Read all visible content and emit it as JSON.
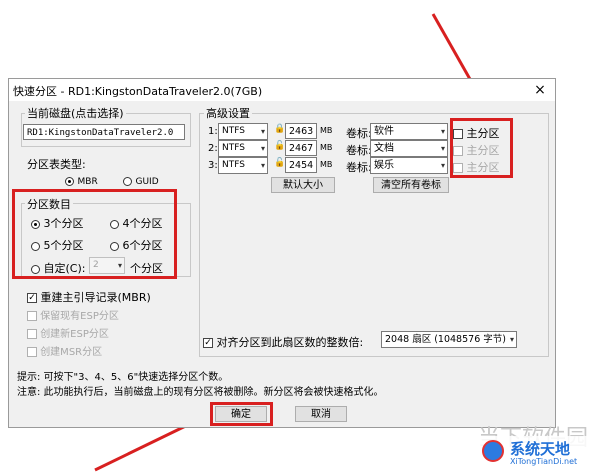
{
  "dialog": {
    "title": "快速分区 - RD1:KingstonDataTraveler2.0(7GB)",
    "close_glyph": "×"
  },
  "disk": {
    "group_label": "当前磁盘(点击选择)",
    "value": "RD1:KingstonDataTraveler2.0"
  },
  "table_type": {
    "label": "分区表类型:",
    "options": [
      "MBR",
      "GUID"
    ],
    "selected": "MBR"
  },
  "partition_count": {
    "group_label": "分区数目",
    "opt3": "3个分区",
    "opt4": "4个分区",
    "opt5": "5个分区",
    "opt6": "6个分区",
    "custom": "自定(C):",
    "custom_value": "2",
    "custom_suffix": "个分区",
    "selected": "3个分区"
  },
  "options": {
    "rebuild_mbr": "重建主引导记录(MBR)",
    "keep_esp": "保留现有ESP分区",
    "create_esp": "创建新ESP分区",
    "create_msr": "创建MSR分区"
  },
  "advanced": {
    "group_label": "高级设置",
    "rows": [
      {
        "num": "1:",
        "fs": "NTFS",
        "size": "2463",
        "unit": "MB",
        "vol_label": "卷标:",
        "name": "软件",
        "primary": "主分区"
      },
      {
        "num": "2:",
        "fs": "NTFS",
        "size": "2467",
        "unit": "MB",
        "vol_label": "卷标:",
        "name": "文档",
        "primary": "主分区"
      },
      {
        "num": "3:",
        "fs": "NTFS",
        "size": "2454",
        "unit": "MB",
        "vol_label": "卷标:",
        "name": "娱乐",
        "primary": "主分区"
      }
    ],
    "default_size_button": "默认大小",
    "clear_labels_button": "清空所有卷标"
  },
  "align": {
    "label": "对齐分区到此扇区数的整数倍:",
    "value": "2048 扇区 (1048576 字节)"
  },
  "hints": {
    "hint": "提示: 可按下\"3、4、5、6\"快速选择分区个数。",
    "note": "注意: 此功能执行后，当前磁盘上的现有分区将被删除。新分区将会被快速格式化。"
  },
  "buttons": {
    "ok": "确定",
    "cancel": "取消"
  },
  "watermark": {
    "name": "系统天地",
    "url": "XiTongTianDi.net",
    "bg_text": "当下软件园"
  },
  "colors": {
    "annotation_red": "#d82020",
    "dialog_bg": "#f0f0f0"
  }
}
